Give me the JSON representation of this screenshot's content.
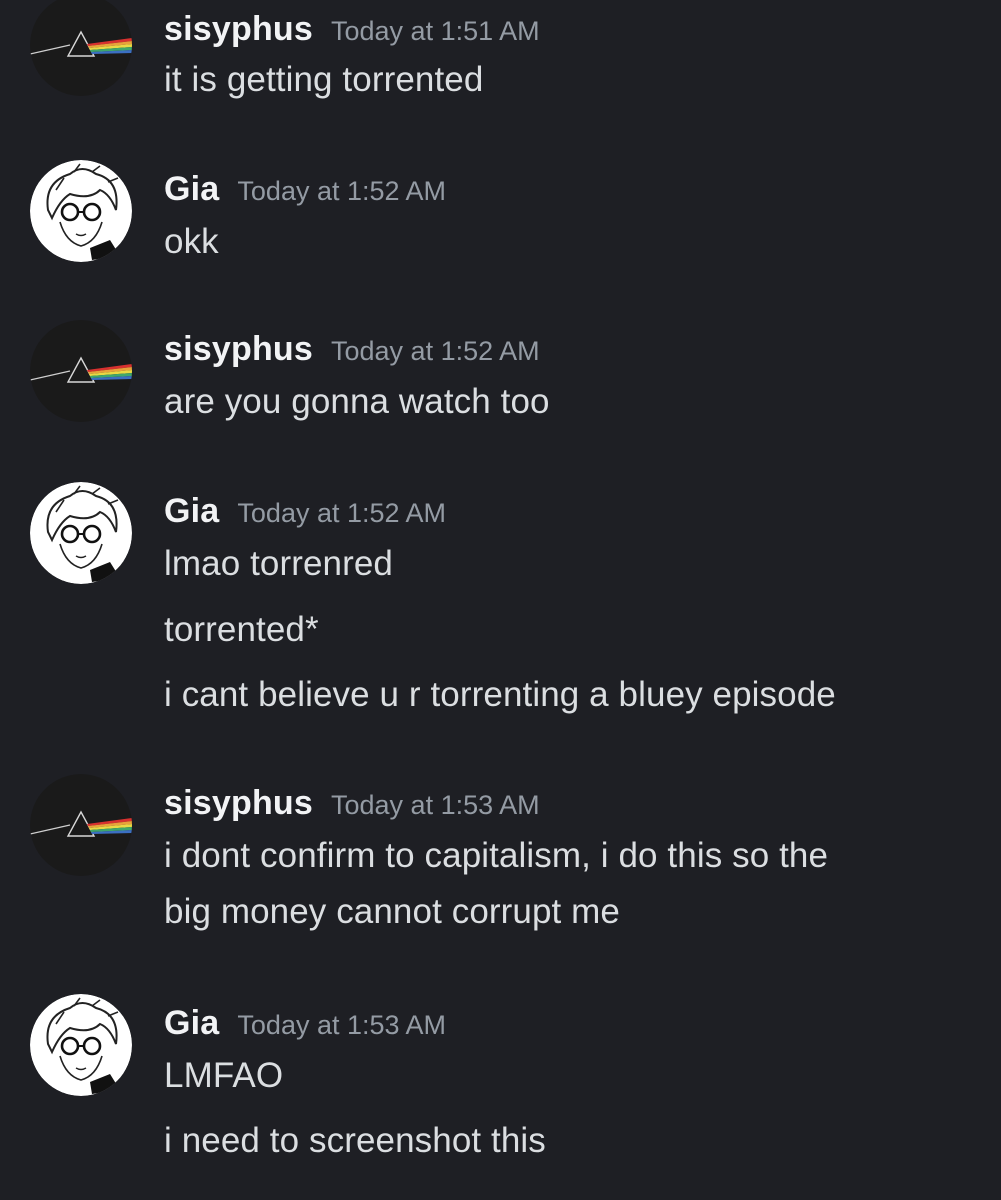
{
  "messages": [
    {
      "user": "sisyphus",
      "avatar": "prism-icon",
      "time": "Today at 1:51 AM",
      "lines": [
        "it is getting torrented"
      ]
    },
    {
      "user": "Gia",
      "avatar": "anime-avatar-icon",
      "time": "Today at 1:52 AM",
      "lines": [
        "okk"
      ]
    },
    {
      "user": "sisyphus",
      "avatar": "prism-icon",
      "time": "Today at 1:52 AM",
      "lines": [
        "are you gonna watch too"
      ]
    },
    {
      "user": "Gia",
      "avatar": "anime-avatar-icon",
      "time": "Today at 1:52 AM",
      "lines": [
        "lmao torrenred",
        "torrented*",
        "i cant believe u r torrenting a bluey episode"
      ]
    },
    {
      "user": "sisyphus",
      "avatar": "prism-icon",
      "time": "Today at 1:53 AM",
      "lines": [
        "i dont confirm to capitalism, i do this so the",
        "big money cannot corrupt me"
      ]
    },
    {
      "user": "Gia",
      "avatar": "anime-avatar-icon",
      "time": "Today at 1:53 AM",
      "lines": [
        "LMFAO",
        "i need to screenshot this"
      ]
    }
  ]
}
